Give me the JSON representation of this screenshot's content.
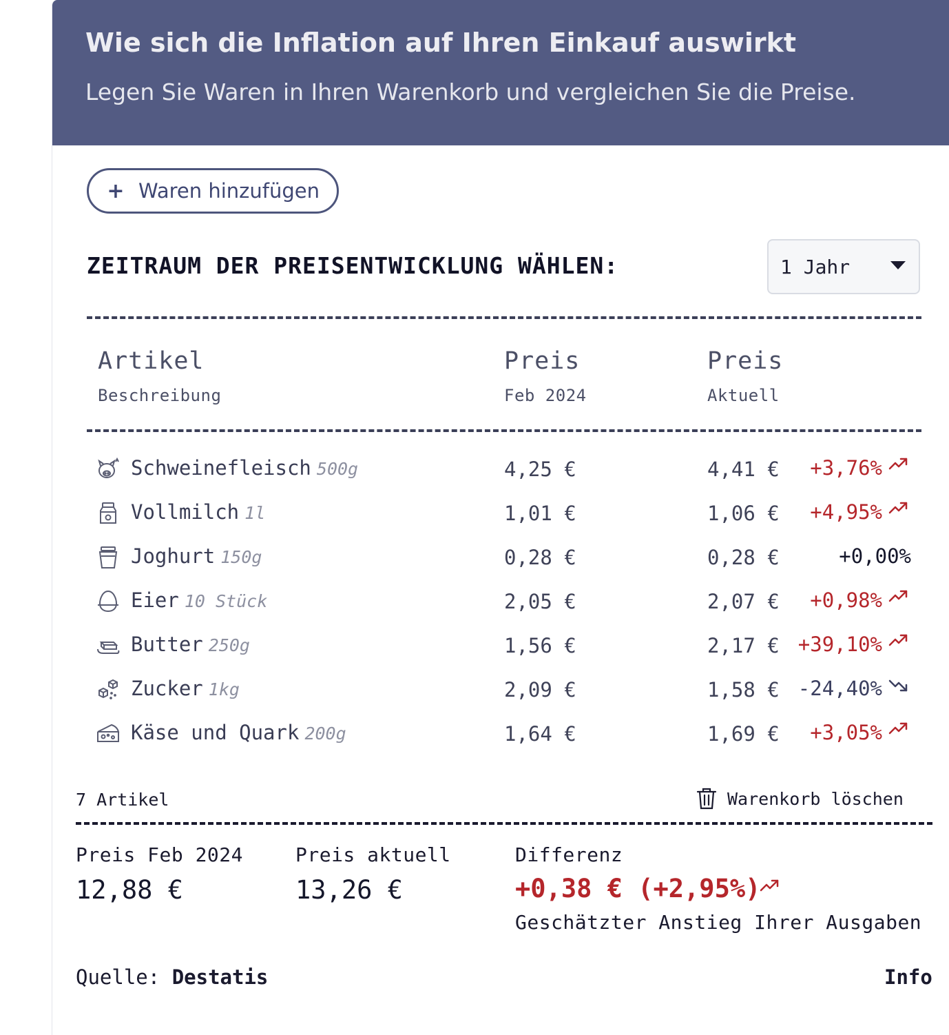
{
  "header": {
    "title": "Wie sich die Inflation auf Ihren Einkauf auswirkt",
    "subtitle": "Legen Sie Waren in Ihren Warenkorb und vergleichen Sie die Preise."
  },
  "add_button": {
    "icon": "plus-icon",
    "label": "Waren hinzufügen"
  },
  "period": {
    "label": "ZEITRAUM DER PREISENTWICKLUNG WÄHLEN:",
    "selected": "1 Jahr"
  },
  "table": {
    "headers": [
      {
        "title": "Artikel",
        "sub": "Beschreibung"
      },
      {
        "title": "Preis",
        "sub": "Feb 2024"
      },
      {
        "title": "Preis",
        "sub": "Aktuell"
      }
    ],
    "rows": [
      {
        "icon": "pig-icon",
        "name": "Schweinefleisch",
        "qty": "500g",
        "old": "4,25 €",
        "now": "4,41 €",
        "pct": "+3,76%",
        "trend": "up"
      },
      {
        "icon": "milk-bottle-icon",
        "name": "Vollmilch",
        "qty": "1l",
        "old": "1,01 €",
        "now": "1,06 €",
        "pct": "+4,95%",
        "trend": "up"
      },
      {
        "icon": "yogurt-icon",
        "name": "Joghurt",
        "qty": "150g",
        "old": "0,28 €",
        "now": "0,28 €",
        "pct": "+0,00%",
        "trend": "none"
      },
      {
        "icon": "egg-icon",
        "name": "Eier",
        "qty": "10 Stück",
        "old": "2,05 €",
        "now": "2,07 €",
        "pct": "+0,98%",
        "trend": "up"
      },
      {
        "icon": "butter-icon",
        "name": "Butter",
        "qty": "250g",
        "old": "1,56 €",
        "now": "2,17 €",
        "pct": "+39,10%",
        "trend": "up"
      },
      {
        "icon": "sugar-cubes-icon",
        "name": "Zucker",
        "qty": "1kg",
        "old": "2,09 €",
        "now": "1,58 €",
        "pct": "-24,40%",
        "trend": "down"
      },
      {
        "icon": "cheese-icon",
        "name": "Käse und Quark",
        "qty": "200g",
        "old": "1,64 €",
        "now": "1,69 €",
        "pct": "+3,05%",
        "trend": "up"
      }
    ]
  },
  "footer": {
    "count": "7 Artikel",
    "clear": {
      "icon": "trash-icon",
      "label": "Warenkorb löschen"
    }
  },
  "summary": {
    "old_label": "Preis Feb 2024",
    "old_value": "12,88 €",
    "now_label": "Preis aktuell",
    "now_value": "13,26 €",
    "diff_label": "Differenz",
    "diff_value": "+0,38 € (+2,95%)",
    "diff_note": "Geschätzter Anstieg Ihrer Ausgaben"
  },
  "source": {
    "label": "Quelle:",
    "name": "Destatis",
    "info": "Info"
  },
  "colors": {
    "header_bg": "#535b83",
    "increase": "#b5262b",
    "decrease": "#3c4060"
  }
}
